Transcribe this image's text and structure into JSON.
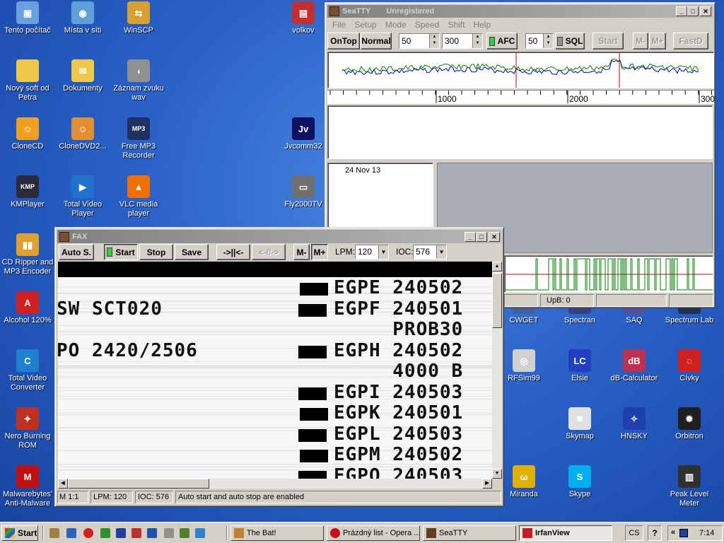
{
  "desktop": {
    "icons": [
      {
        "label": "Tento počítač",
        "color": "#6aa0e0",
        "glyph": "▣"
      },
      {
        "label": "Místa v síti",
        "color": "#5fa0d8",
        "glyph": "◉"
      },
      {
        "label": "WinSCP",
        "color": "#d8a030",
        "glyph": "⇆"
      },
      {
        "label": "volkov",
        "color": "#c03030",
        "glyph": "▤"
      },
      {
        "label": "Nový soft od Petra",
        "color": "#f0c848",
        "glyph": ""
      },
      {
        "label": "Dokumenty",
        "color": "#f0c848",
        "glyph": "✉"
      },
      {
        "label": "Záznam zvuku wav",
        "color": "#909090",
        "glyph": "◖"
      },
      {
        "label": "CloneCD",
        "color": "#f0a020",
        "glyph": "☺"
      },
      {
        "label": "CloneDVD2...",
        "color": "#e09030",
        "glyph": "☺"
      },
      {
        "label": "Free MP3 Recorder",
        "color": "#203060",
        "glyph": "MP3"
      },
      {
        "label": "Jvcomm32",
        "color": "#101060",
        "glyph": "Jv"
      },
      {
        "label": "KMPlayer",
        "color": "#2a2a3a",
        "glyph": "KMP"
      },
      {
        "label": "Total Video Player",
        "color": "#2070d0",
        "glyph": "▶"
      },
      {
        "label": "VLC media player",
        "color": "#f07000",
        "glyph": "▲"
      },
      {
        "label": "Fly2000TV",
        "color": "#707070",
        "glyph": "▭"
      },
      {
        "label": "CD Ripper and MP3 Encoder",
        "color": "#e0a030",
        "glyph": "▮▮"
      },
      {
        "label": "Alcohol 120%",
        "color": "#d02020",
        "glyph": "A"
      },
      {
        "label": "Total Video Converter",
        "color": "#2080d0",
        "glyph": "C"
      },
      {
        "label": "Nero Burning ROM",
        "color": "#c03020",
        "glyph": "✦"
      },
      {
        "label": "Malwarebytes' Anti-Malware",
        "color": "#c01010",
        "glyph": "M"
      },
      {
        "label": "CWGET",
        "color": "#4060a0",
        "glyph": "✎"
      },
      {
        "label": "Spectran",
        "color": "#304080",
        "glyph": "S"
      },
      {
        "label": "SAQ",
        "color": "#5050a0",
        "glyph": "Q"
      },
      {
        "label": "Spectrum Lab",
        "color": "#203050",
        "glyph": "▦"
      },
      {
        "label": "RFSim99",
        "color": "#d0d0d0",
        "glyph": "◎"
      },
      {
        "label": "Elsie",
        "color": "#2040c0",
        "glyph": "LC"
      },
      {
        "label": "dB-Calculator",
        "color": "#c03050",
        "glyph": "dB"
      },
      {
        "label": "Cívky",
        "color": "#d02020",
        "glyph": "◌"
      },
      {
        "label": "Skymap",
        "color": "#e0e0e0",
        "glyph": "✸"
      },
      {
        "label": "HNSKY",
        "color": "#2040b0",
        "glyph": "✧"
      },
      {
        "label": "Orbitron",
        "color": "#202020",
        "glyph": "✹"
      },
      {
        "label": "Miranda",
        "color": "#e0b000",
        "glyph": "ω"
      },
      {
        "label": "Skype",
        "color": "#00aff0",
        "glyph": "S"
      },
      {
        "label": "Peak Level Meter",
        "color": "#303030",
        "glyph": "▥"
      }
    ]
  },
  "seatty": {
    "title": "SeaTTY",
    "status": "Unregistered",
    "menu": [
      "File",
      "Setup",
      "Mode",
      "Speed",
      "Shift",
      "Help"
    ],
    "toolbar": {
      "ontop": "OnTop",
      "normal": "Normal",
      "spin1": "50",
      "spin2": "300",
      "afc": "AFC",
      "spin3": "50",
      "sql": "SQL",
      "start": "Start",
      "mminus": "M-",
      "mplus": "M+",
      "fastd": "FastD"
    },
    "scale": [
      "1000",
      "2000",
      "300"
    ],
    "date": "24 Nov 13",
    "upb": "UpB: 0"
  },
  "fax": {
    "title": "FAX",
    "toolbar": {
      "auto": "Auto S.",
      "start": "Start",
      "stop": "Stop",
      "save": "Save",
      "fwd": "->||<-",
      "back": "<-//->",
      "mminus": "M-",
      "mplus": "M+",
      "lpm_label": "LPM:",
      "lpm_value": "120",
      "ioc_label": "IOC:",
      "ioc_value": "576"
    },
    "lines": [
      {
        "left": "",
        "right": "EGPE 240502"
      },
      {
        "left": "SW SCT020",
        "right": "EGPF 240501"
      },
      {
        "left": "",
        "right": "     PROB30"
      },
      {
        "left": "PO 2420/2506",
        "right": "EGPH 240502"
      },
      {
        "left": "",
        "right": "     4000 B"
      },
      {
        "left": "",
        "right": "EGPI 240503"
      },
      {
        "left": "",
        "right": "EGPK 240501"
      },
      {
        "left": "",
        "right": "EGPL 240503"
      },
      {
        "left": "",
        "right": "EGPM 240502"
      },
      {
        "left": "",
        "right": "EGPO 240503"
      }
    ],
    "statusbar": {
      "zoom": "M 1:1",
      "lpm": "LPM: 120",
      "ioc": "IOC: 576",
      "message": "Auto start and auto stop are enabled"
    }
  },
  "taskbar": {
    "start": "Start",
    "tasks": [
      {
        "label": "The Bat!",
        "color": "#c08030"
      },
      {
        "label": "Prázdný list - Opera ...",
        "color": "#cc0f16"
      },
      {
        "label": "SeaTTY",
        "color": "#604020"
      },
      {
        "label": "IrfanView",
        "color": "#c02020"
      }
    ],
    "lang": "CS",
    "clock": "7:14"
  },
  "colors": {
    "desktop": "#2b62c9",
    "title_active": "#0a246a",
    "spectrum_green": "#008000",
    "spectrum_blue": "#0000c0",
    "marker_red": "#c00000",
    "led_green": "#30d040"
  }
}
